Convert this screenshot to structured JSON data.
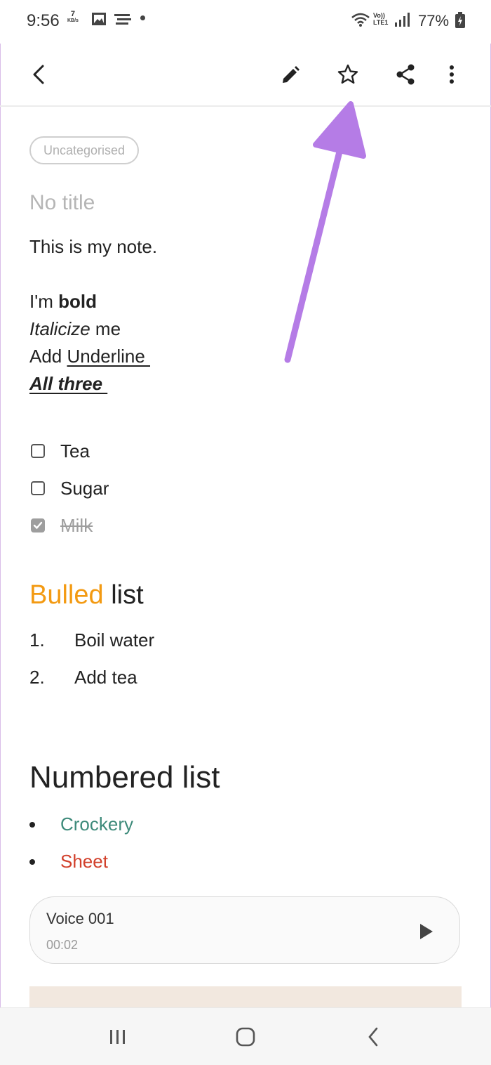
{
  "status_bar": {
    "time": "9:56",
    "net_speed_value": "7",
    "net_speed_unit": "KB/s",
    "volte_top": "Vo))",
    "volte_bottom": "LTE1",
    "battery": "77%"
  },
  "toolbar": {
    "icons": [
      "back-arrow-icon",
      "pencil-icon",
      "star-icon",
      "share-icon",
      "more-vert-icon"
    ]
  },
  "note": {
    "category": "Uncategorised",
    "title_placeholder": "No title",
    "line1": "This is my note.",
    "bold_prefix": "I'm ",
    "bold_word": "bold",
    "italic_word": "Italicize",
    "italic_suffix": " me",
    "underline_prefix": "Add ",
    "underline_word": "Underline ",
    "all_three": "All three ",
    "checklist": [
      {
        "label": "Tea",
        "checked": false
      },
      {
        "label": "Sugar",
        "checked": false
      },
      {
        "label": "Milk",
        "checked": true
      }
    ],
    "bulled_heading_colored": "Bulled",
    "bulled_heading_rest": " list",
    "ordered_items": [
      {
        "num": "1.",
        "text": "Boil water"
      },
      {
        "num": "2.",
        "text": "Add tea"
      }
    ],
    "numbered_heading": "Numbered list",
    "bullet_items": [
      {
        "text": "Crockery",
        "color": "#3d8a7a"
      },
      {
        "text": "Sheet",
        "color": "#d2402b"
      }
    ],
    "voice": {
      "name": "Voice 001",
      "duration": "00:02"
    }
  },
  "colors": {
    "orange_heading": "#f39a12",
    "annotation_arrow": "#b57ce6"
  },
  "navbar": {
    "icons": [
      "recent-apps-icon",
      "home-icon",
      "back-icon"
    ]
  }
}
